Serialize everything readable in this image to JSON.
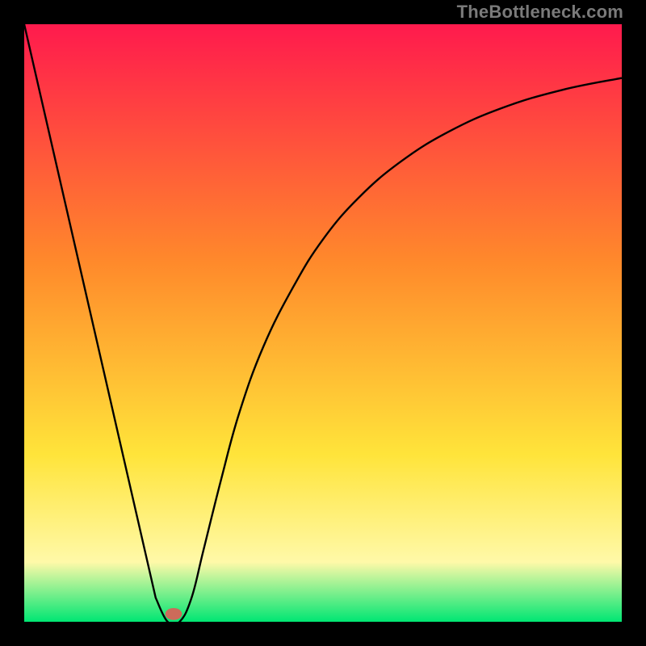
{
  "watermark": "TheBottleneck.com",
  "chart_data": {
    "type": "line",
    "title": "",
    "xlabel": "",
    "ylabel": "",
    "xlim": [
      0,
      100
    ],
    "ylim": [
      0,
      100
    ],
    "grid": false,
    "axes": false,
    "background_gradient": {
      "top": "#ff1a4d",
      "mid1": "#ff8a2b",
      "mid2": "#ffe43a",
      "mid3": "#fff9a8",
      "bottom": "#00e673"
    },
    "series": [
      {
        "name": "curve",
        "x": [
          0,
          22,
          24,
          26,
          28,
          30,
          33,
          36,
          40,
          45,
          50,
          56,
          63,
          71,
          80,
          90,
          100
        ],
        "y": [
          100,
          4,
          0,
          0,
          4,
          12,
          24,
          35,
          46,
          56,
          64,
          71,
          77,
          82,
          86,
          89,
          91
        ],
        "color": "#000000",
        "stroke_width": 2.4
      }
    ],
    "marker": {
      "x": 25,
      "y": 1.3,
      "rx": 1.4,
      "ry": 1.0,
      "color": "#cc6b5a"
    }
  }
}
